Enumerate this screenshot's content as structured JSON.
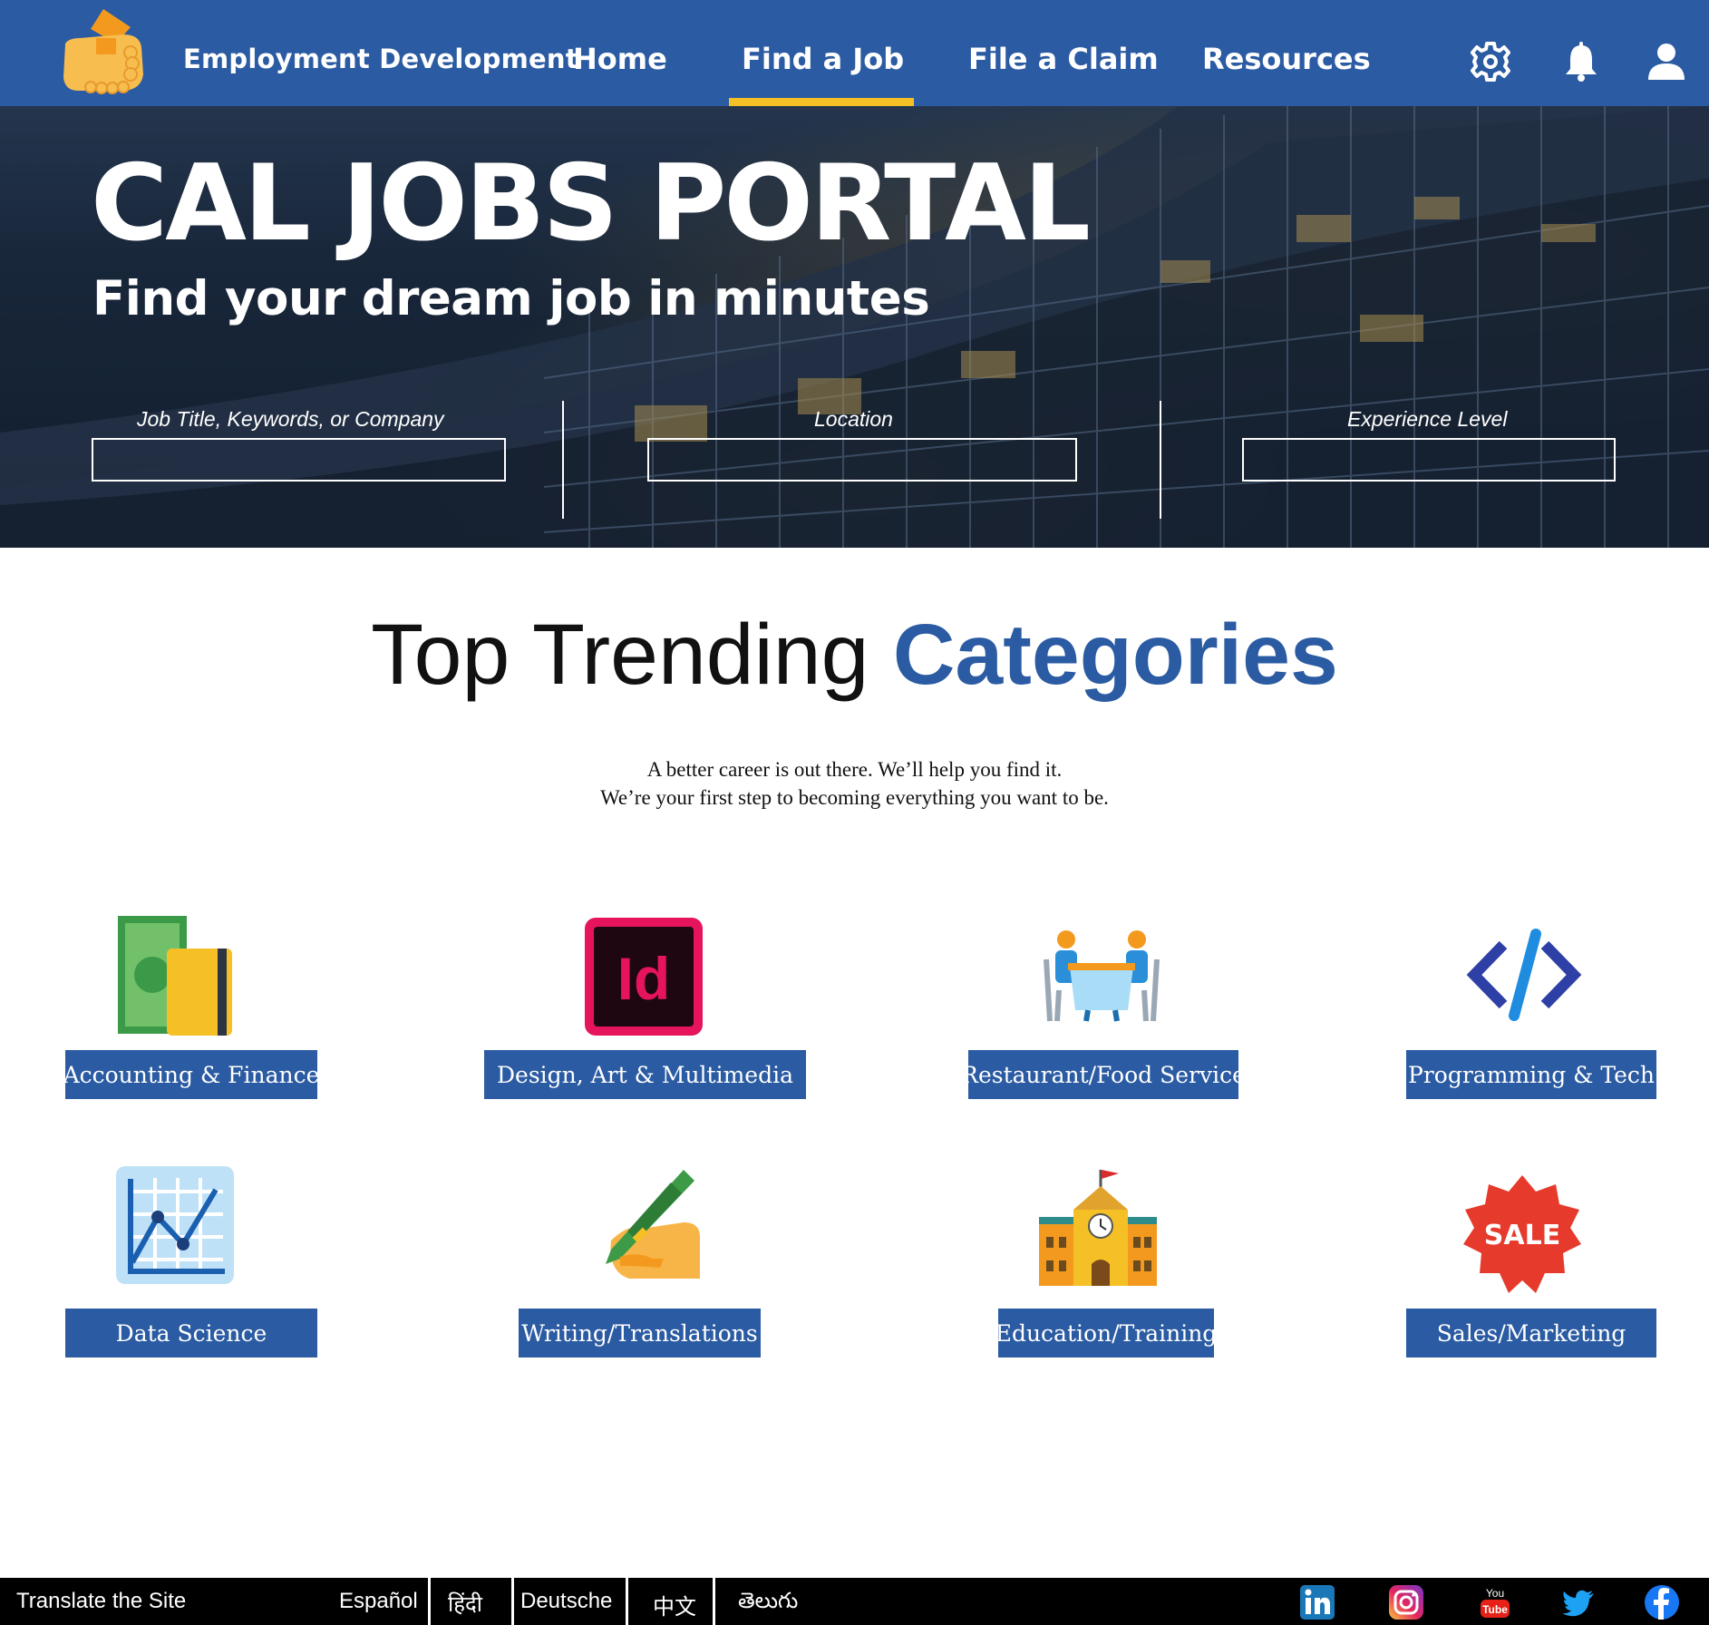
{
  "nav": {
    "brand": "Employment Development",
    "links": [
      "Home",
      "Find a Job",
      "File a Claim",
      "Resources"
    ],
    "active": "Find a Job",
    "icons": [
      "gear-icon",
      "bell-icon",
      "user-icon"
    ],
    "colors": {
      "bar": "#2b5ba2",
      "active_underline": "#f5c026"
    }
  },
  "hero": {
    "title": "CAL JOBS PORTAL",
    "subtitle": "Find your dream job  in minutes",
    "fields": [
      {
        "label": "Job Title, Keywords, or Company",
        "value": ""
      },
      {
        "label": "Location",
        "value": ""
      },
      {
        "label": "Experience Level",
        "value": ""
      }
    ]
  },
  "categories_section": {
    "title_plain": "Top Trending ",
    "title_accent": "Categories",
    "tagline_line1": "A better career is out there.  We’ll help you find it.",
    "tagline_line2": "We’re your first step to becoming everything you want to be.",
    "accent_color": "#2b5ba2",
    "items": [
      {
        "label": "Accounting & Finance",
        "icon": "money-card-icon"
      },
      {
        "label": "Design, Art & Multimedia",
        "icon": "indesign-icon"
      },
      {
        "label": "Restaurant/Food Service",
        "icon": "dining-table-icon"
      },
      {
        "label": "Programming & Tech",
        "icon": "code-icon"
      },
      {
        "label": "Data Science",
        "icon": "line-chart-icon"
      },
      {
        "label": "Writing/Translations",
        "icon": "pen-hand-icon"
      },
      {
        "label": "Education/Training",
        "icon": "school-building-icon"
      },
      {
        "label": "Sales/Marketing",
        "icon": "sale-badge-icon"
      }
    ]
  },
  "footer": {
    "translate_label": "Translate the Site",
    "languages": [
      "Español",
      "हिंदी",
      "Deutsche",
      "中文",
      "తెలుగు"
    ],
    "social": [
      "linkedin-icon",
      "instagram-icon",
      "youtube-icon",
      "twitter-icon",
      "facebook-icon"
    ]
  }
}
